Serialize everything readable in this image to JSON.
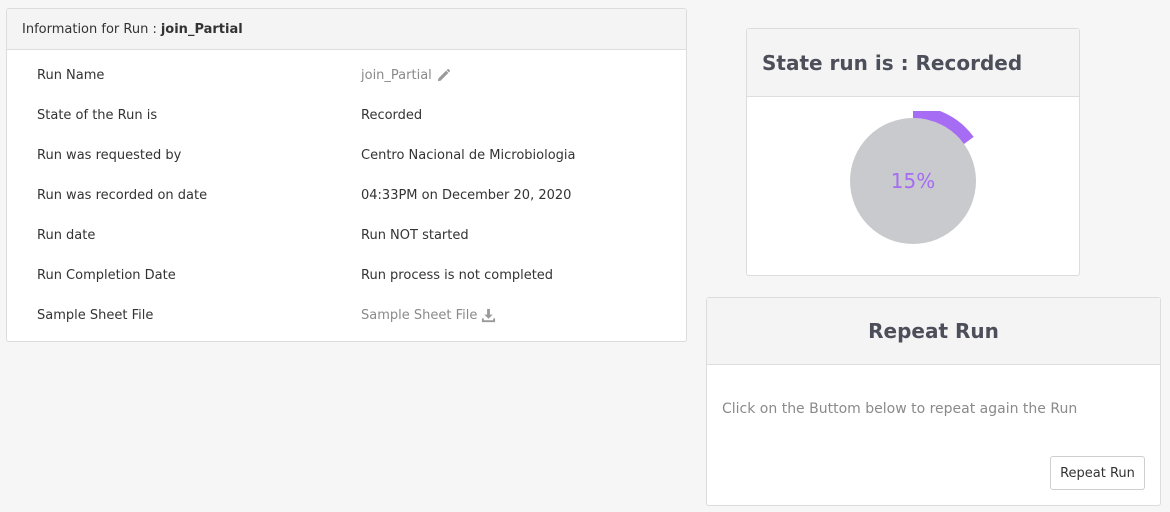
{
  "info": {
    "header_prefix": "Information for Run :",
    "run_name_header": "join_Partial",
    "rows": [
      {
        "label": "Run Name",
        "value": "join_Partial",
        "style": "muted",
        "icon": "edit-pencil-icon"
      },
      {
        "label": "State of the Run is",
        "value": "Recorded"
      },
      {
        "label": "Run was requested by",
        "value": "Centro Nacional de Microbiologia"
      },
      {
        "label": "Run was recorded on date",
        "value": "04:33PM on December 20, 2020"
      },
      {
        "label": "Run date",
        "value": "Run NOT started"
      },
      {
        "label": "Run Completion Date",
        "value": "Run process is not completed"
      },
      {
        "label": "Sample Sheet File",
        "value": "Sample Sheet File",
        "style": "muted",
        "icon": "download-icon"
      }
    ]
  },
  "state": {
    "title": "State run is : Recorded",
    "progress_percent": 15,
    "progress_label": "15%",
    "colors": {
      "arc": "#a66cf3",
      "circle": "#c8cacd"
    }
  },
  "repeat": {
    "title": "Repeat Run",
    "description": "Click on the Buttom below to repeat again the Run",
    "button_label": "Repeat Run"
  }
}
